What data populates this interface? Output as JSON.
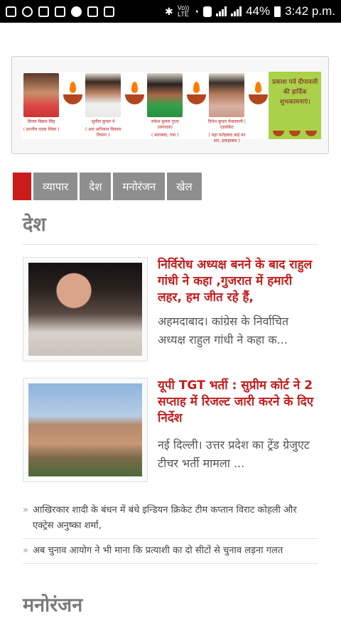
{
  "status_bar": {
    "network_label_top": "Vo))",
    "network_label_bottom": "LTE",
    "battery_percent": "44%",
    "time": "3:42 p.m."
  },
  "banner": {
    "people": [
      {
        "name": "विजय विक्रम सिंह",
        "caption": "( प्रान्तीय एडवा प्लिस )"
      },
      {
        "name": "सुनील कुमार ने",
        "caption": "( अरा अभियान विकास विभाग )"
      },
      {
        "name": "राकेश कुमार गुप्ता (संपादक)",
        "caption": "( सदरबाद, गया )"
      },
      {
        "name": "दिनेश कुमार केसरवानी | एडवोकेट ",
        "caption": "( यहा फतेहबाद बाई का सन, इलाहाबाद )"
      }
    ],
    "greeting": "प्रकाश पर्व दीपावली की हार्दिक शुभकामनाएं।"
  },
  "tabs": [
    "व्यापार",
    "देश",
    "मनोरंजन",
    "खेल"
  ],
  "section_title": "देश",
  "articles": [
    {
      "title": "निर्विरोध अध्यक्ष बनने के बाद राहुल गांधी ने कहा ,गुजरात में हमारी लहर, हम जीत रहे हैं,",
      "excerpt": "अहमदाबाद। कांग्रेस के निर्वाचित अध्यक्ष राहुल गांधी ने कहा क..."
    },
    {
      "title": "यूपी TGT भर्ती : सुप्रीम कोर्ट ने 2 सप्ताह में रिजल्ट जारी करने के दिए निर्देश",
      "excerpt": "नई दिल्ली। उत्तर प्रदेश का ट्रेंड ग्रेजुएट टीचर भर्ती मामला ..."
    }
  ],
  "list_items": [
    "आखिरकार शादी के बंधन में बंधे इन्डियन क्रिकेट टीम कप्तान विराट कोहली और एक्ट्रेस अनुष्का शर्मा,",
    "अब चुनाव आयोग ने भी माना कि प्रत्याशी का दो सीटों से चुनाव लड़ना गलत"
  ],
  "list_bullet": "»",
  "section2_title": "मनोरंजन"
}
